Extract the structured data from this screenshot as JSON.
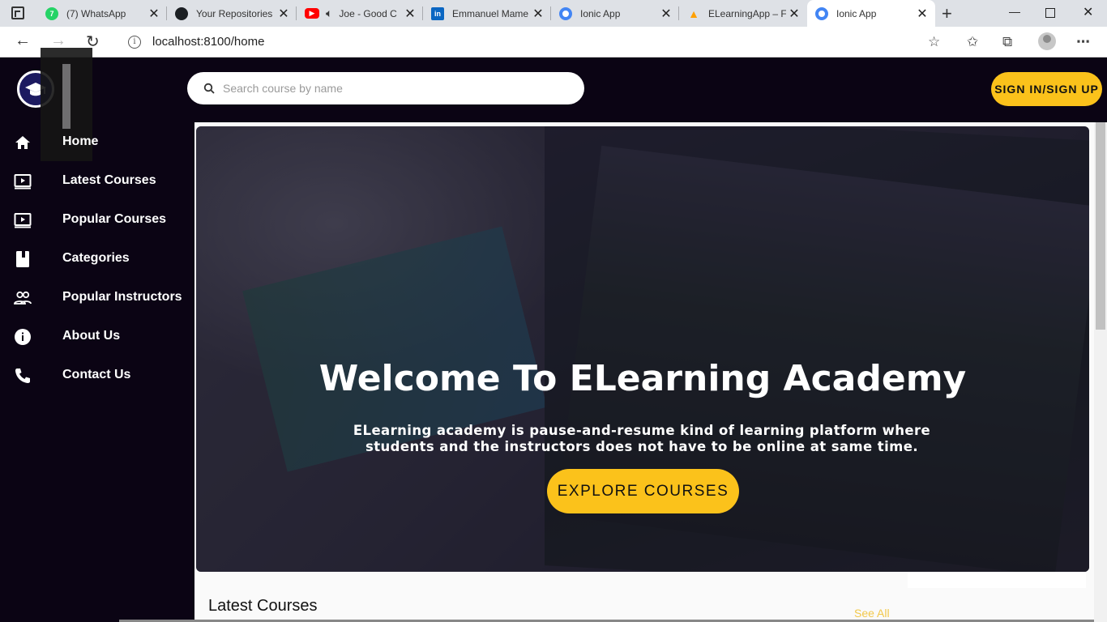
{
  "browser": {
    "tabs": [
      {
        "title": "(7) WhatsApp",
        "icon": "whatsapp-icon",
        "color": "#25d366",
        "badge": "7"
      },
      {
        "title": "Your Repositories",
        "icon": "github-icon",
        "color": "#1b1f23"
      },
      {
        "title": "Joe - Good C",
        "icon": "youtube-icon",
        "color": "#ff0000"
      },
      {
        "title": "Emmanuel Mame",
        "icon": "linkedin-icon",
        "color": "#0a66c2"
      },
      {
        "title": "Ionic App",
        "icon": "ionic-icon",
        "color": "#4285f4"
      },
      {
        "title": "ELearningApp – F",
        "icon": "firebase-icon",
        "color": "#ffca28"
      },
      {
        "title": "Ionic App",
        "icon": "ionic-icon",
        "color": "#4285f4",
        "active": true
      }
    ],
    "url": "localhost:8100/home"
  },
  "header": {
    "search_placeholder": "Search course by name",
    "signin_label": "SIGN IN/SIGN UP"
  },
  "sidebar": {
    "items": [
      {
        "label": "Home",
        "icon": "home-icon"
      },
      {
        "label": "Latest Courses",
        "icon": "video-icon"
      },
      {
        "label": "Popular Courses",
        "icon": "video-icon"
      },
      {
        "label": "Categories",
        "icon": "book-icon"
      },
      {
        "label": "Popular Instructors",
        "icon": "people-icon"
      },
      {
        "label": "About Us",
        "icon": "info-icon"
      },
      {
        "label": "Contact Us",
        "icon": "phone-icon"
      }
    ]
  },
  "hero": {
    "title": "Welcome To ELearning Academy",
    "subtitle": "ELearning academy is pause-and-resume kind of learning platform where students and the instructors does not have to be online at same time.",
    "button_label": "EXPLORE COURSES"
  },
  "sections": {
    "latest_title": "Latest Courses",
    "see_all": "See All"
  },
  "colors": {
    "accent": "#fbc21b",
    "background": "#0b0414"
  }
}
